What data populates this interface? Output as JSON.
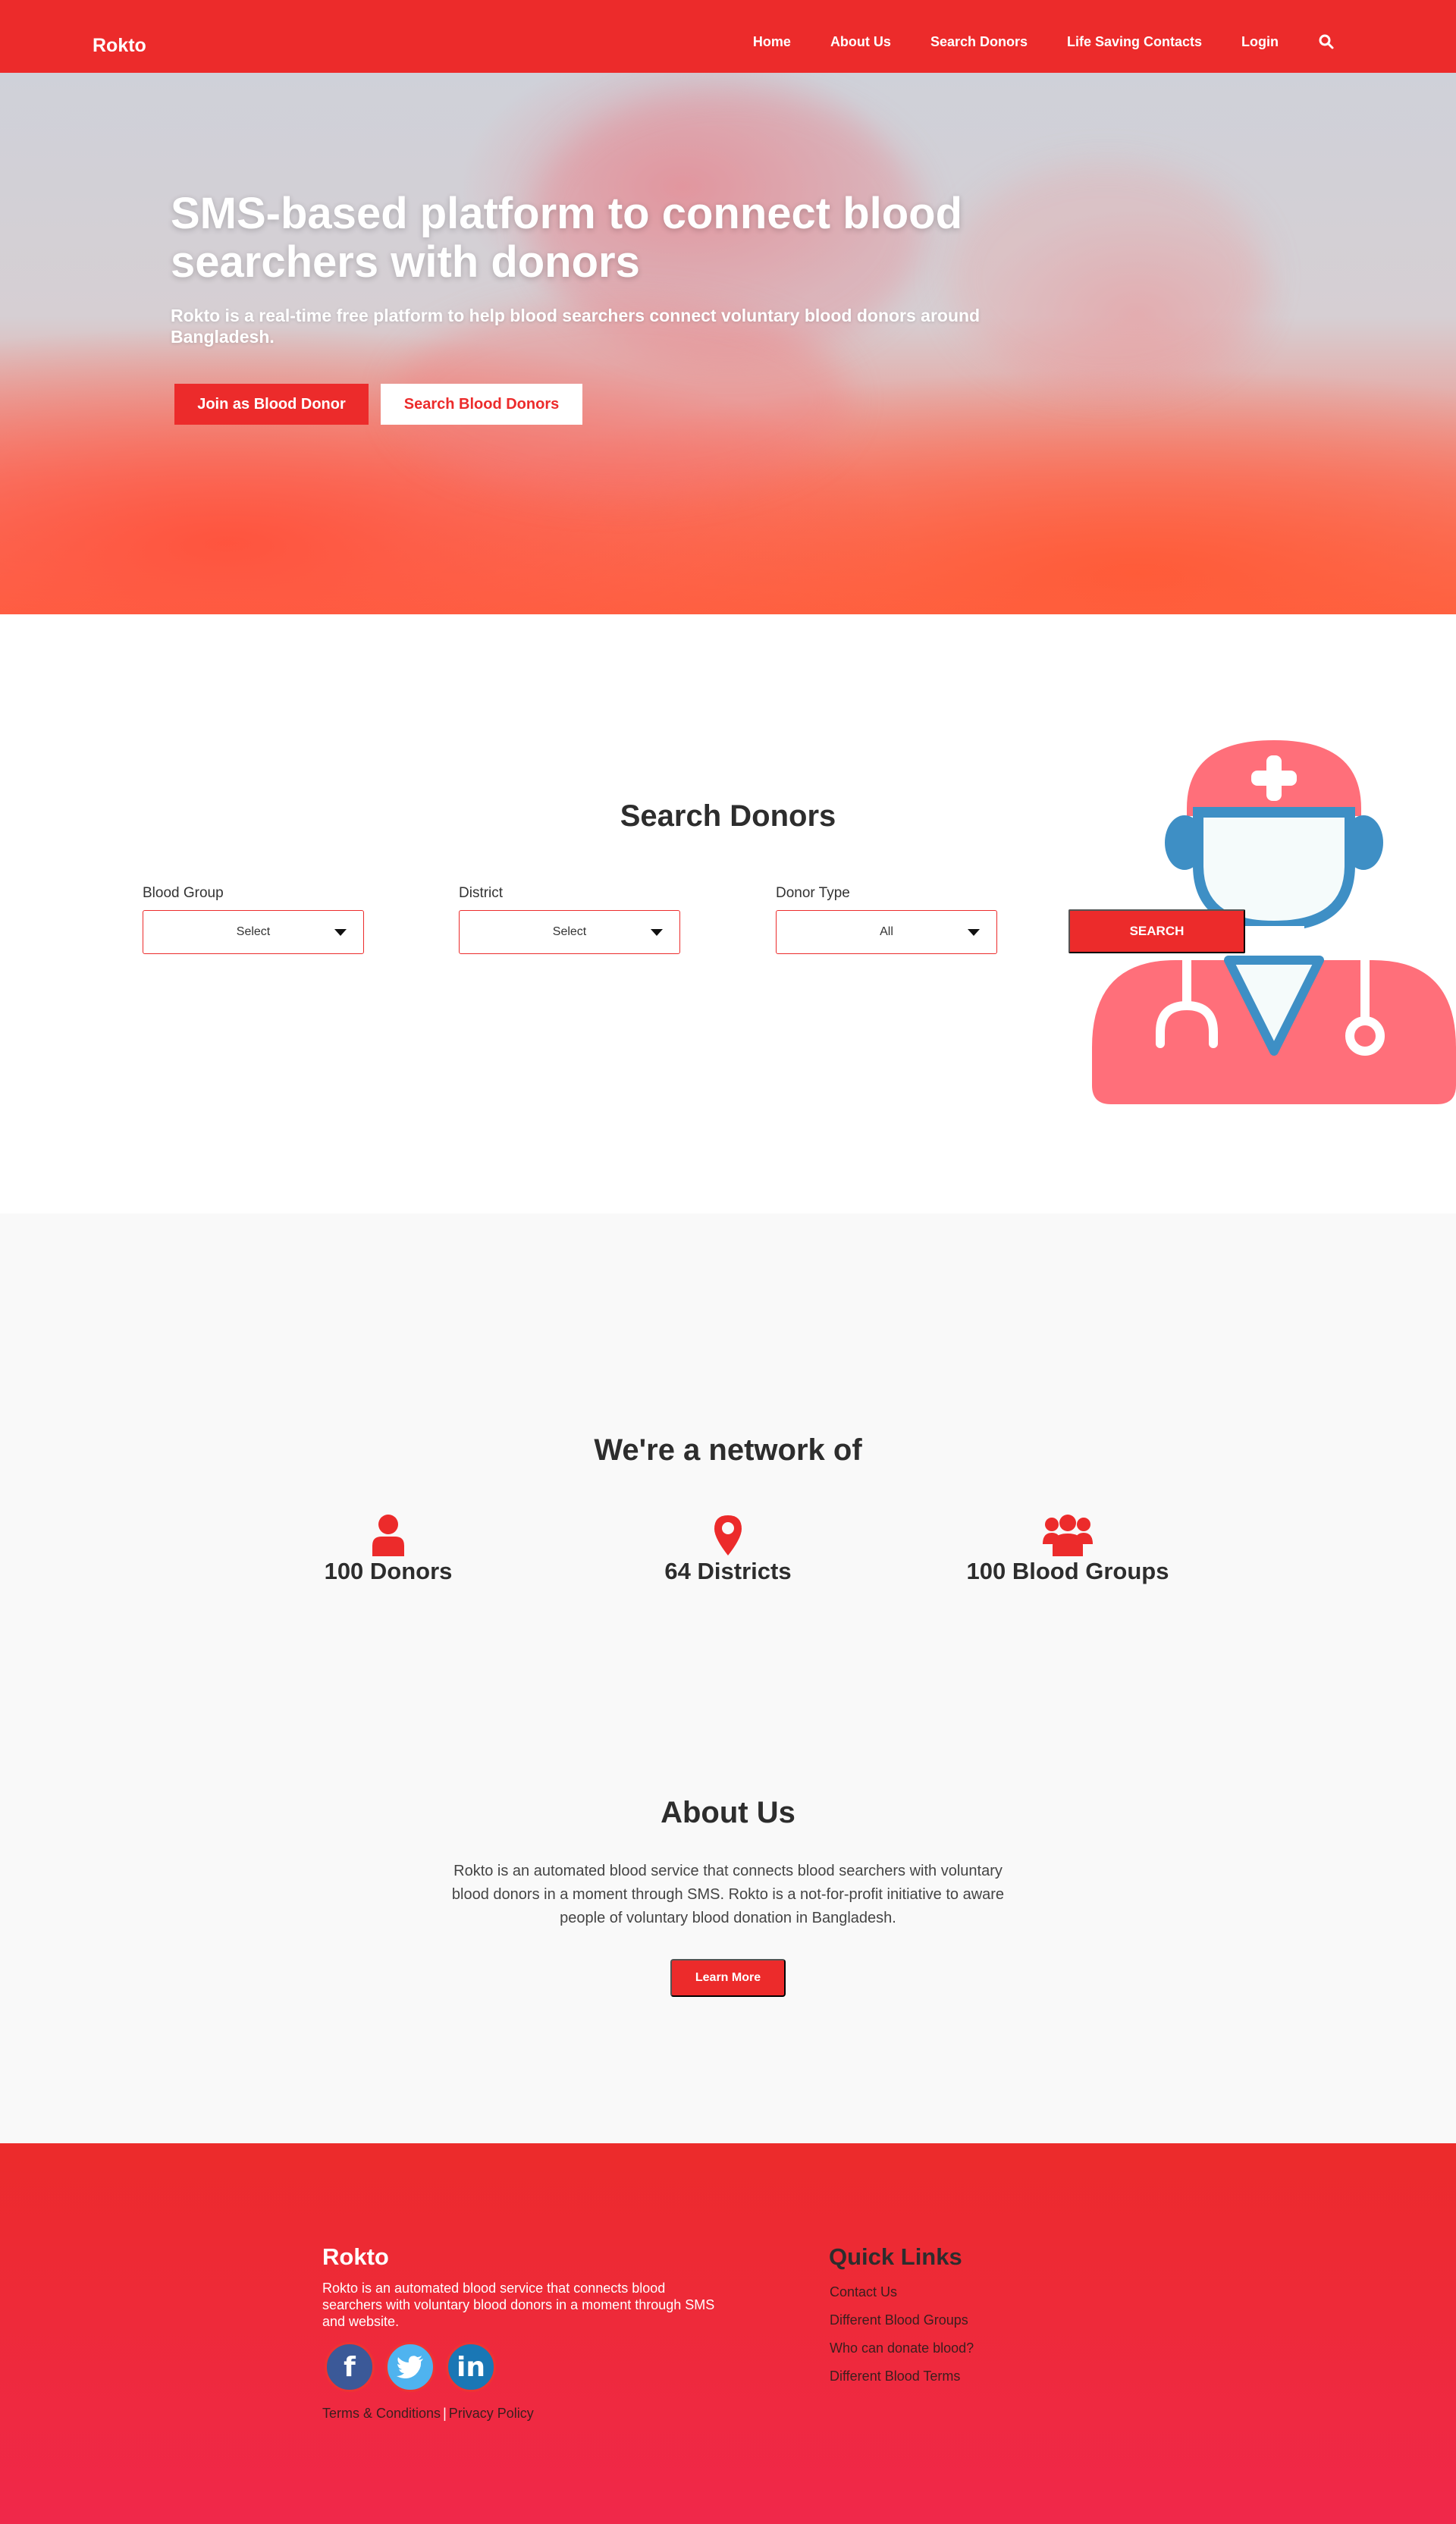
{
  "navbar": {
    "brand": "Rokto",
    "items": [
      {
        "label": "Home"
      },
      {
        "label": "About Us"
      },
      {
        "label": "Search Donors"
      },
      {
        "label": "Life Saving Contacts"
      },
      {
        "label": "Login"
      }
    ],
    "search_icon": "search-icon"
  },
  "hero": {
    "title": "SMS-based platform to connect blood searchers with donors",
    "subtitle": "Rokto is a real-time free platform to help blood searchers connect voluntary blood donors around Bangladesh.",
    "primary_button": "Join as Blood Donor",
    "secondary_button": "Search Blood Donors"
  },
  "search": {
    "title": "Search Donors",
    "fields": [
      {
        "label": "Blood Group",
        "value": "Select"
      },
      {
        "label": "District",
        "value": "Select"
      },
      {
        "label": "Donor Type",
        "value": "All"
      }
    ],
    "button": "SEARCH",
    "illustration": "doctor-icon"
  },
  "network": {
    "title": "We're a network of",
    "stats": [
      {
        "icon": "user-icon",
        "label": "100 Donors"
      },
      {
        "icon": "map-marker-icon",
        "label": "64 Districts"
      },
      {
        "icon": "users-icon",
        "label": "100 Blood Groups"
      }
    ]
  },
  "about": {
    "title": "About Us",
    "text": "Rokto is an automated blood service that connects blood searchers with voluntary blood donors in a moment through SMS. Rokto is a not-for-profit initiative to aware people of voluntary blood donation in Bangladesh.",
    "button": "Learn More"
  },
  "footer": {
    "brand": "Rokto",
    "description": "Rokto is an automated blood service that connects blood searchers with voluntary blood donors in a moment through SMS and website.",
    "socials": [
      {
        "icon": "facebook-icon",
        "glyph": "f"
      },
      {
        "icon": "twitter-icon",
        "glyph": "t"
      },
      {
        "icon": "linkedin-icon",
        "glyph": "in"
      }
    ],
    "terms": "Terms & Conditions",
    "separator": "|",
    "privacy": "Privacy Policy",
    "quick_links_title": "Quick Links",
    "quick_links": [
      {
        "label": "Contact Us"
      },
      {
        "label": "Different Blood Groups"
      },
      {
        "label": "Who can donate blood?"
      },
      {
        "label": "Different Blood Terms"
      }
    ]
  },
  "colors": {
    "brand_red": "#ec2b2b",
    "footer_bottom": "#f0284a",
    "section_gray": "#f9f9f9"
  }
}
